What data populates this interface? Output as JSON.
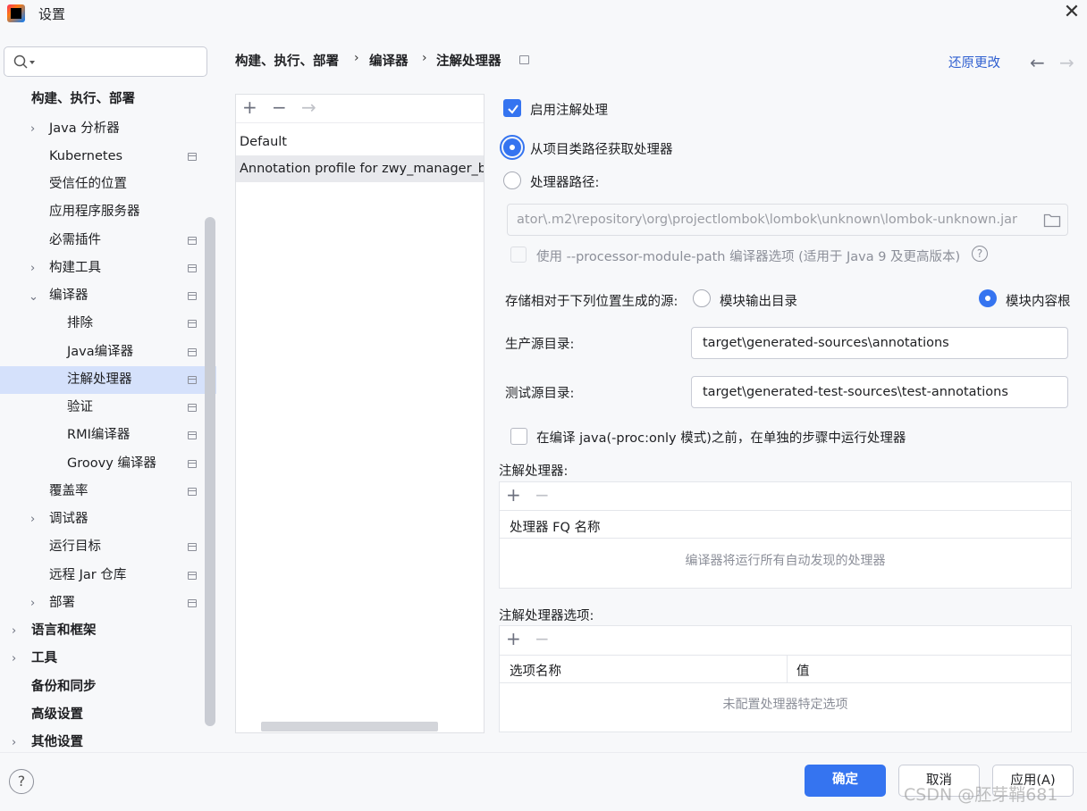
{
  "window": {
    "title": "设置"
  },
  "search": {
    "placeholder": ""
  },
  "sidebar": {
    "items": [
      {
        "label": "构建、执行、部署",
        "bold": true
      },
      {
        "label": "Java 分析器"
      },
      {
        "label": "Kubernetes"
      },
      {
        "label": "受信任的位置"
      },
      {
        "label": "应用程序服务器"
      },
      {
        "label": "必需插件"
      },
      {
        "label": "构建工具"
      },
      {
        "label": "编译器"
      },
      {
        "label": "排除"
      },
      {
        "label": "Java编译器"
      },
      {
        "label": "注解处理器",
        "selected": true
      },
      {
        "label": "验证"
      },
      {
        "label": "RMI编译器"
      },
      {
        "label": "Groovy 编译器"
      },
      {
        "label": "覆盖率"
      },
      {
        "label": "调试器"
      },
      {
        "label": "运行目标"
      },
      {
        "label": "远程 Jar 仓库"
      },
      {
        "label": "部署"
      },
      {
        "label": "语言和框架",
        "bold": true
      },
      {
        "label": "工具",
        "bold": true
      },
      {
        "label": "备份和同步",
        "bold": true
      },
      {
        "label": "高级设置",
        "bold": true
      },
      {
        "label": "其他设置",
        "bold": true
      }
    ]
  },
  "breadcrumb": {
    "part1": "构建、执行、部署",
    "part2": "编译器",
    "part3": "注解处理器",
    "sep": "›"
  },
  "header": {
    "reset_label": "还原更改"
  },
  "profiles": {
    "items": [
      "Default",
      "Annotation profile for zwy_manager_b"
    ]
  },
  "settings": {
    "enable_label": "启用注解处理",
    "from_classpath_label": "从项目类路径获取处理器",
    "processor_path_label": "处理器路径:",
    "processor_path_value": "ator\\.m2\\repository\\org\\projectlombok\\lombok\\unknown\\lombok-unknown.jar",
    "module_path_label": "使用 --processor-module-path 编译器选项 (适用于 Java 9 及更高版本)",
    "store_label": "存储相对于下列位置生成的源:",
    "module_output_label": "模块输出目录",
    "module_content_label": "模块内容根",
    "prod_dir_label": "生产源目录:",
    "prod_dir_value": "target\\generated-sources\\annotations",
    "test_dir_label": "测试源目录:",
    "test_dir_value": "target\\generated-test-sources\\test-annotations",
    "separate_step_label": "在编译 java(-proc:only 模式)之前，在单独的步骤中运行处理器"
  },
  "processors_table": {
    "title": "注解处理器:",
    "column": "处理器 FQ 名称",
    "empty_text": "编译器将运行所有自动发现的处理器"
  },
  "options_table": {
    "title": "注解处理器选项:",
    "col_name": "选项名称",
    "col_value": "值",
    "empty_text": "未配置处理器特定选项"
  },
  "footer": {
    "ok_label": "确定",
    "cancel_label": "取消",
    "apply_label": "应用(A)",
    "watermark": "CSDN @胚芽鞘681"
  },
  "colors": {
    "accent": "#3574f0",
    "selection": "#d5e1fb",
    "link": "#2f5fd0"
  }
}
